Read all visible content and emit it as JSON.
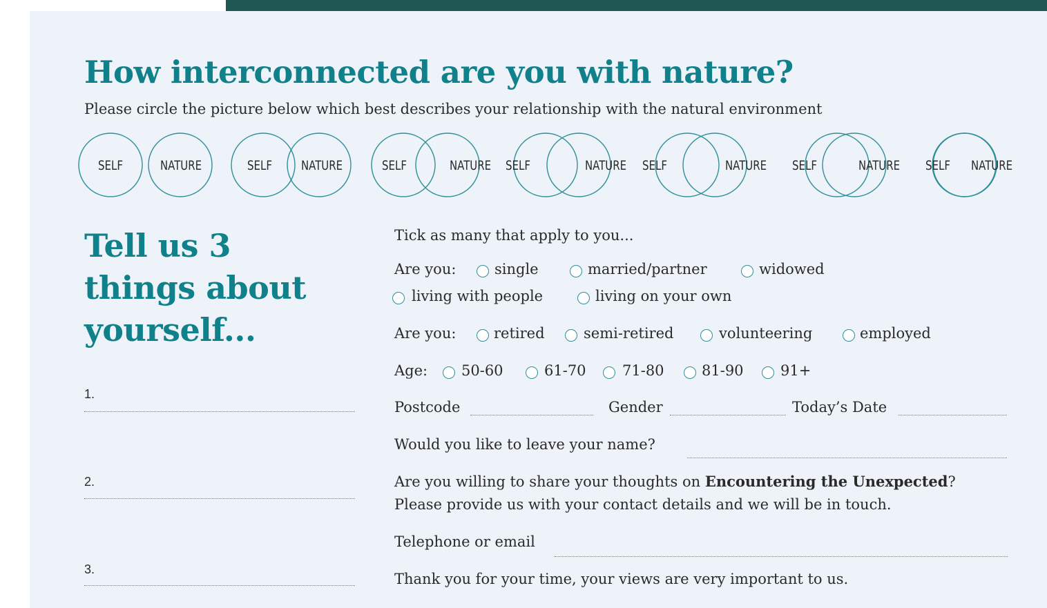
{
  "header": {
    "title": "How interconnected are you with nature?",
    "subtitle": "Please circle the picture below which best describes your relationship with the natural environment"
  },
  "diagram": {
    "self_label": "SELF",
    "nature_label": "NATURE",
    "options": [
      {
        "self": "SELF",
        "nature": "NATURE"
      },
      {
        "self": "SELF",
        "nature": "NATURE"
      },
      {
        "self": "SELF",
        "nature": "NATURE"
      },
      {
        "self": "SELF",
        "nature": "NATURE"
      },
      {
        "self": "SELF",
        "nature": "NATURE"
      },
      {
        "self": "SELF",
        "nature": "NATURE"
      },
      {
        "self": "SELF",
        "nature": "NATURE"
      }
    ],
    "stroke_color": "#2f8f98"
  },
  "about": {
    "title": "Tell us 3 things about yourself...",
    "items": [
      "1.",
      "2.",
      "3."
    ]
  },
  "form": {
    "intro": "Tick as many that apply to you...",
    "status_prompt": "Are you:",
    "status_options": [
      "single",
      "married/partner",
      "widowed",
      "living with people",
      "living on your own"
    ],
    "work_prompt": "Are you:",
    "work_options": [
      "retired",
      "semi-retired",
      "volunteering",
      "employed"
    ],
    "age_prompt": "Age:",
    "age_options": [
      "50-60",
      "61-70",
      "71-80",
      "81-90",
      "91+"
    ],
    "postcode_label": "Postcode",
    "gender_label": "Gender",
    "date_label": "Today’s Date",
    "name_prompt": "Would you like to leave your name?",
    "share_prefix": "Are you willing to share your thoughts on ",
    "share_bold": "Encountering the Unexpected",
    "share_suffix": "?",
    "share_line2": "Please provide us with your contact details and we will be in touch.",
    "contact_label": "Telephone or email",
    "thanks": "Thank you for your time, your views are very important to us."
  },
  "colors": {
    "accent": "#10808a",
    "top_bar": "#1f5552",
    "panel": "#edf3f8"
  }
}
